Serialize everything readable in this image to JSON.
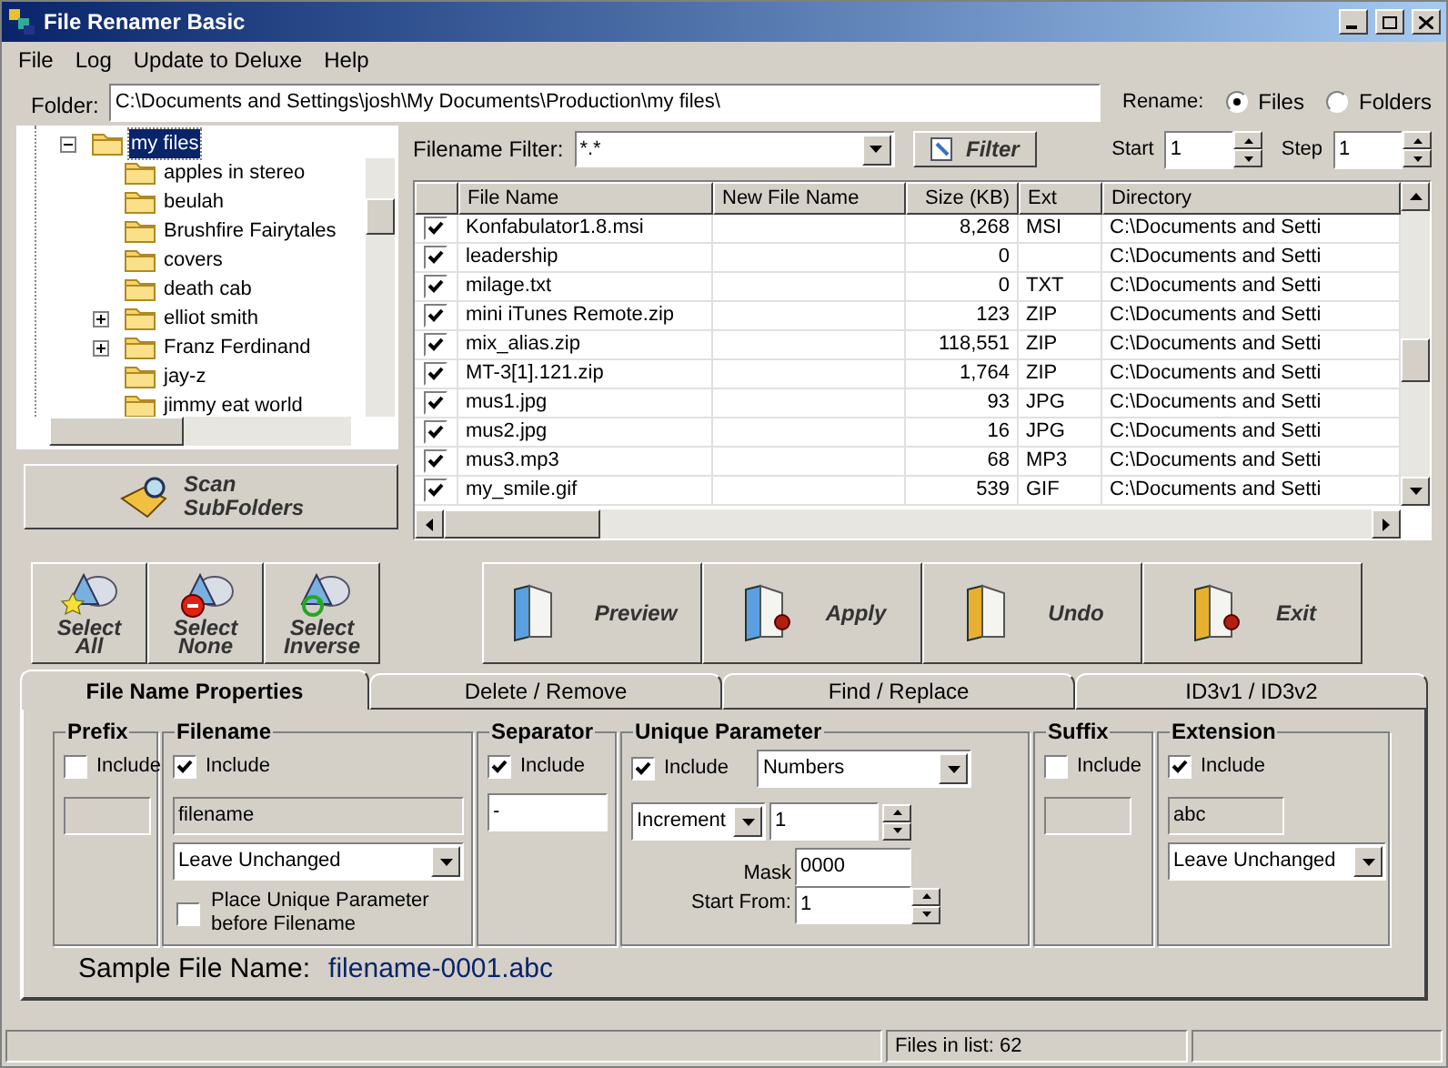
{
  "window": {
    "title": "File Renamer Basic"
  },
  "menu": [
    "File",
    "Log",
    "Update to Deluxe",
    "Help"
  ],
  "folder": {
    "label": "Folder:",
    "value": "C:\\Documents and Settings\\josh\\My Documents\\Production\\my files\\"
  },
  "rename": {
    "label": "Rename:",
    "options": [
      {
        "label": "Files",
        "selected": true
      },
      {
        "label": "Folders",
        "selected": false
      }
    ]
  },
  "tree": [
    {
      "label": "my files",
      "selected": true,
      "expandable": true,
      "expanded": true,
      "children": [
        {
          "label": "apples in stereo",
          "selected": false,
          "expandable": false
        },
        {
          "label": "beulah",
          "selected": false,
          "expandable": false
        },
        {
          "label": "Brushfire Fairytales",
          "selected": false,
          "expandable": false
        },
        {
          "label": "covers",
          "selected": false,
          "expandable": false
        },
        {
          "label": "death cab",
          "selected": false,
          "expandable": false
        },
        {
          "label": "elliot smith",
          "selected": false,
          "expandable": true,
          "expanded": false
        },
        {
          "label": "Franz Ferdinand",
          "selected": false,
          "expandable": true,
          "expanded": false
        },
        {
          "label": "jay-z",
          "selected": false,
          "expandable": false
        },
        {
          "label": "jimmy eat world",
          "selected": false,
          "expandable": false
        }
      ]
    }
  ],
  "scan_button": {
    "line1": "Scan",
    "line2": "SubFolders"
  },
  "filter": {
    "label": "Filename Filter:",
    "value": "*.*",
    "button": "Filter"
  },
  "start": {
    "label": "Start",
    "value": "1"
  },
  "step": {
    "label": "Step",
    "value": "1"
  },
  "table": {
    "columns": [
      "File Name",
      "New File Name",
      "Size (KB)",
      "Ext",
      "Directory"
    ],
    "rows": [
      {
        "checked": true,
        "name": "Konfabulator1.8.msi",
        "new_name": "",
        "size": "8,268",
        "ext": "MSI",
        "dir": "C:\\Documents and Setti"
      },
      {
        "checked": true,
        "name": "leadership",
        "new_name": "",
        "size": "0",
        "ext": "",
        "dir": "C:\\Documents and Setti"
      },
      {
        "checked": true,
        "name": "milage.txt",
        "new_name": "",
        "size": "0",
        "ext": "TXT",
        "dir": "C:\\Documents and Setti"
      },
      {
        "checked": true,
        "name": "mini iTunes Remote.zip",
        "new_name": "",
        "size": "123",
        "ext": "ZIP",
        "dir": "C:\\Documents and Setti"
      },
      {
        "checked": true,
        "name": "mix_alias.zip",
        "new_name": "",
        "size": "118,551",
        "ext": "ZIP",
        "dir": "C:\\Documents and Setti"
      },
      {
        "checked": true,
        "name": "MT-3[1].121.zip",
        "new_name": "",
        "size": "1,764",
        "ext": "ZIP",
        "dir": "C:\\Documents and Setti"
      },
      {
        "checked": true,
        "name": "mus1.jpg",
        "new_name": "",
        "size": "93",
        "ext": "JPG",
        "dir": "C:\\Documents and Setti"
      },
      {
        "checked": true,
        "name": "mus2.jpg",
        "new_name": "",
        "size": "16",
        "ext": "JPG",
        "dir": "C:\\Documents and Setti"
      },
      {
        "checked": true,
        "name": "mus3.mp3",
        "new_name": "",
        "size": "68",
        "ext": "MP3",
        "dir": "C:\\Documents and Setti"
      },
      {
        "checked": true,
        "name": "my_smile.gif",
        "new_name": "",
        "size": "539",
        "ext": "GIF",
        "dir": "C:\\Documents and Setti"
      }
    ]
  },
  "select_buttons": [
    {
      "kind": "all",
      "line1": "Select",
      "line2": "All"
    },
    {
      "kind": "none",
      "line1": "Select",
      "line2": "None"
    },
    {
      "kind": "inverse",
      "line1": "Select",
      "line2": "Inverse"
    }
  ],
  "action_buttons": [
    {
      "kind": "preview",
      "label": "Preview"
    },
    {
      "kind": "apply",
      "label": "Apply"
    },
    {
      "kind": "undo",
      "label": "Undo"
    },
    {
      "kind": "exit",
      "label": "Exit"
    }
  ],
  "tabs": [
    {
      "label": "File Name Properties",
      "selected": true
    },
    {
      "label": "Delete / Remove",
      "selected": false
    },
    {
      "label": "Find / Replace",
      "selected": false
    },
    {
      "label": "ID3v1 / ID3v2",
      "selected": false
    }
  ],
  "prefix": {
    "title": "Prefix",
    "include": {
      "label": "Include",
      "checked": false
    },
    "disabled": true
  },
  "filename": {
    "title": "Filename",
    "include": {
      "label": "Include",
      "checked": true
    },
    "value": "filename",
    "disabled": true,
    "case": "Leave Unchanged",
    "place_before": {
      "label": "Place Unique Parameter before Filename",
      "checked": false
    }
  },
  "separator": {
    "title": "Separator",
    "include": {
      "label": "Include",
      "checked": true
    },
    "value": "-",
    "disabled": false
  },
  "unique": {
    "title": "Unique Parameter",
    "include": {
      "label": "Include",
      "checked": true
    },
    "type": "Numbers",
    "mode": "Increment",
    "increment": "1",
    "mask_label": "Mask",
    "mask": "0000",
    "start_label": "Start From:",
    "start": "1"
  },
  "suffix": {
    "title": "Suffix",
    "include": {
      "label": "Include",
      "checked": false
    },
    "disabled": true
  },
  "extension": {
    "title": "Extension",
    "include": {
      "label": "Include",
      "checked": true
    },
    "value": "abc",
    "disabled": true,
    "case": "Leave Unchanged"
  },
  "sample": {
    "label": "Sample File Name:",
    "value": "filename-0001.abc"
  },
  "status_bar": {
    "files_count": "Files in list: 62"
  }
}
